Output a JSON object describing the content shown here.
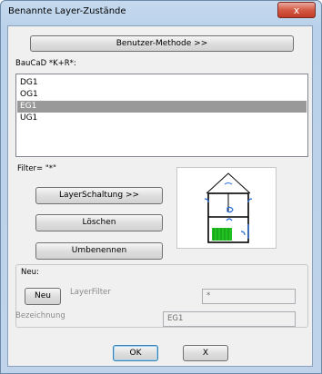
{
  "window": {
    "title": "Benannte Layer-Zustände",
    "close_label": "x"
  },
  "buttons": {
    "method": "Benutzer-Methode >>",
    "layer_switch": "LayerSchaltung >>",
    "delete": "Löschen",
    "rename": "Umbenennen",
    "new": "Neu",
    "ok": "OK",
    "cancel": "X"
  },
  "list": {
    "label": "BauCaD *K+R*:",
    "items": [
      "DG1",
      "OG1",
      "EG1",
      "UG1"
    ],
    "selected": "EG1"
  },
  "filter": {
    "label": "Filter= \"*\""
  },
  "new_group": {
    "label": "Neu:",
    "layerfilter_label": "LayerFilter",
    "layerfilter_value": "*",
    "designation_label": "Bezeichnung",
    "designation_value": "EG1"
  },
  "colors": {
    "selection": "#999999",
    "preview_green": "#22c022",
    "preview_blue": "#2a6fd6"
  }
}
